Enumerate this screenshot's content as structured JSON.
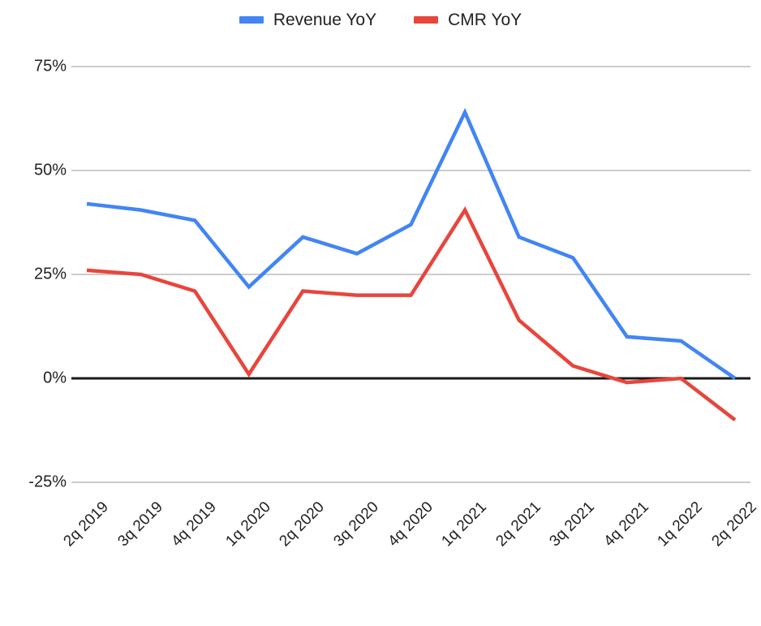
{
  "chart_data": {
    "type": "line",
    "title": "",
    "subtitle": "",
    "xlabel": "",
    "ylabel": "",
    "ylim": [
      -25,
      75
    ],
    "yticks": [
      75,
      50,
      25,
      0,
      -25
    ],
    "ytick_labels": [
      "75%",
      "50%",
      "25%",
      "0%",
      "-25%"
    ],
    "grid": true,
    "legend_position": "top-center",
    "zero_line": true,
    "categories": [
      "2q 2019",
      "3q 2019",
      "4q 2019",
      "1q 2020",
      "2q 2020",
      "3q 2020",
      "4q 2020",
      "1q 2021",
      "2q 2021",
      "3q 2021",
      "4q 2021",
      "1q 2022",
      "2q 2022"
    ],
    "series": [
      {
        "name": "Revenue YoY",
        "color": "#4285F4",
        "values": [
          42,
          40.5,
          38,
          22,
          34,
          30,
          37,
          64,
          34,
          29,
          10,
          9,
          0
        ]
      },
      {
        "name": "CMR YoY",
        "color": "#E8453C",
        "values": [
          26,
          25,
          21,
          1,
          21,
          20,
          20,
          40.5,
          14,
          3,
          -1,
          0,
          -10
        ]
      }
    ]
  },
  "legend": {
    "items": [
      {
        "label": "Revenue YoY",
        "color": "#4285F4",
        "swatch_name": "legend-swatch-revenue"
      },
      {
        "label": "CMR YoY",
        "color": "#E8453C",
        "swatch_name": "legend-swatch-cmr"
      }
    ]
  },
  "axis": {
    "y_tick_labels": [
      "75%",
      "50%",
      "25%",
      "0%",
      "-25%"
    ],
    "x_tick_labels": [
      "2q 2019",
      "3q 2019",
      "4q 2019",
      "1q 2020",
      "2q 2020",
      "3q 2020",
      "4q 2020",
      "1q 2021",
      "2q 2021",
      "3q 2021",
      "4q 2021",
      "1q 2022",
      "2q 2022"
    ]
  },
  "colors": {
    "revenue": "#4285F4",
    "cmr": "#E8453C",
    "gridline": "#CCCCCC",
    "zero_axis": "#1A1A1A",
    "text": "#222222",
    "background": "#FFFFFF"
  }
}
